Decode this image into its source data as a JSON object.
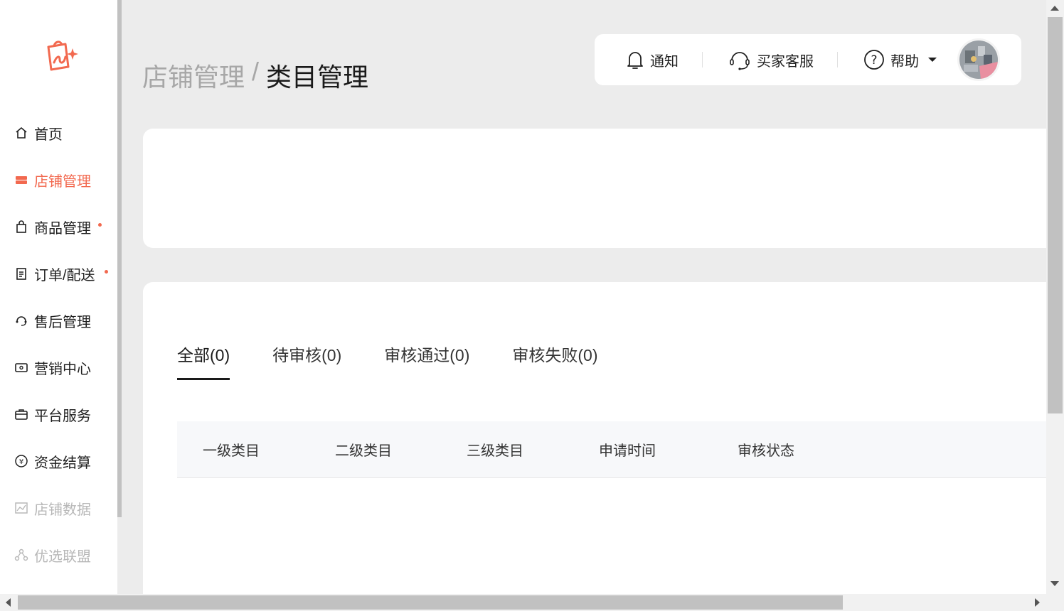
{
  "colors": {
    "accent": "#f2694f",
    "disabled": "#b8b8b8",
    "text": "#1f1f1f"
  },
  "sidebar": {
    "items": [
      {
        "label": "首页",
        "icon": "home-icon"
      },
      {
        "label": "店铺管理",
        "icon": "store-icon",
        "active": true
      },
      {
        "label": "商品管理",
        "icon": "bag-icon",
        "badge_dot": true
      },
      {
        "label": "订单/配送",
        "icon": "clipboard-icon",
        "badge_dot": true
      },
      {
        "label": "售后管理",
        "icon": "headset-icon"
      },
      {
        "label": "营销中心",
        "icon": "ticket-icon"
      },
      {
        "label": "平台服务",
        "icon": "briefcase-icon"
      },
      {
        "label": "资金结算",
        "icon": "yen-icon"
      },
      {
        "label": "店铺数据",
        "icon": "chart-icon",
        "disabled": true
      },
      {
        "label": "优选联盟",
        "icon": "share-icon",
        "disabled": true
      }
    ]
  },
  "breadcrumb": {
    "parent": "店铺管理",
    "separator": "/",
    "current": "类目管理"
  },
  "toolbar": {
    "notify": "通知",
    "service": "买家客服",
    "help": "帮助"
  },
  "tabs": [
    {
      "label": "全部(0)",
      "active": true
    },
    {
      "label": "待审核(0)"
    },
    {
      "label": "审核通过(0)"
    },
    {
      "label": "审核失败(0)"
    }
  ],
  "table": {
    "columns": [
      "一级类目",
      "二级类目",
      "三级类目",
      "申请时间",
      "审核状态"
    ]
  }
}
